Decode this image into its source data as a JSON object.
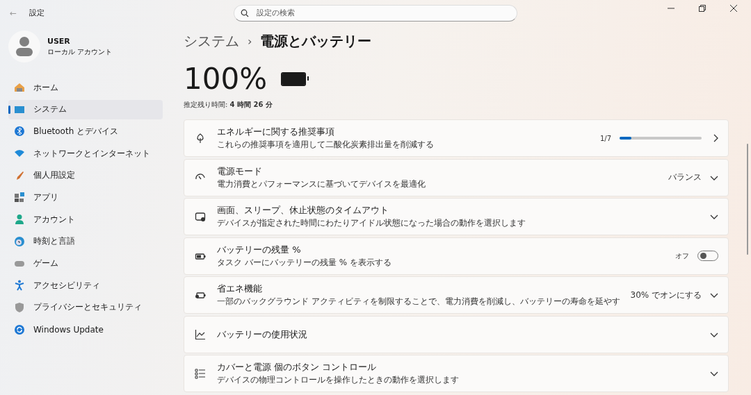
{
  "window": {
    "back": "←",
    "title": "設定"
  },
  "search": {
    "placeholder": "設定の検索"
  },
  "user": {
    "name": "USER",
    "account": "ローカル アカウント"
  },
  "sidebar": {
    "items": [
      {
        "label": "ホーム",
        "selected": false
      },
      {
        "label": "システム",
        "selected": true
      },
      {
        "label": "Bluetooth とデバイス",
        "selected": false
      },
      {
        "label": "ネットワークとインターネット",
        "selected": false
      },
      {
        "label": "個人用設定",
        "selected": false
      },
      {
        "label": "アプリ",
        "selected": false
      },
      {
        "label": "アカウント",
        "selected": false
      },
      {
        "label": "時刻と言語",
        "selected": false
      },
      {
        "label": "ゲーム",
        "selected": false
      },
      {
        "label": "アクセシビリティ",
        "selected": false
      },
      {
        "label": "プライバシーとセキュリティ",
        "selected": false
      },
      {
        "label": "Windows Update",
        "selected": false
      }
    ]
  },
  "breadcrumb": {
    "parent": "システム",
    "separator": "›",
    "current": "電源とバッテリー"
  },
  "battery": {
    "percent": "100%",
    "level": 1,
    "estimate": "推定残り時間: **4 時間 26 分**"
  },
  "cards": [
    {
      "kind": "progress",
      "title": "エネルギーに関する推奨事項",
      "subtitle": "これらの推奨事項を適用して二酸化炭素排出量を削減する",
      "value": "1/7",
      "level": 0.14
    },
    {
      "kind": "dropdown",
      "title": "電源モード",
      "subtitle": "電力消費とパフォーマンスに基づいてデバイスを最適化",
      "value": "バランス"
    },
    {
      "kind": "expand",
      "title": "画面、スリープ、休止状態のタイムアウト",
      "subtitle": "デバイスが指定された時間にわたりアイドル状態になった場合の動作を選択します"
    },
    {
      "kind": "toggle",
      "title": "バッテリーの残量 %",
      "subtitle": "タスク バーにバッテリーの残量 % を表示する",
      "value": "オフ",
      "on": false
    },
    {
      "kind": "dropdown",
      "title": "省エネ機能",
      "subtitle": "一部のバックグラウンド アクティビティを制限することで、電力消費を削減し、バッテリーの寿命を延やす",
      "value": "30% でオンにする"
    },
    {
      "kind": "expand",
      "title": "バッテリーの使用状況"
    },
    {
      "kind": "expand",
      "title": "カバーと電源 個のボタン コントロール",
      "subtitle": "デバイスの物理コントロールを操作したときの動作を選択します"
    }
  ]
}
